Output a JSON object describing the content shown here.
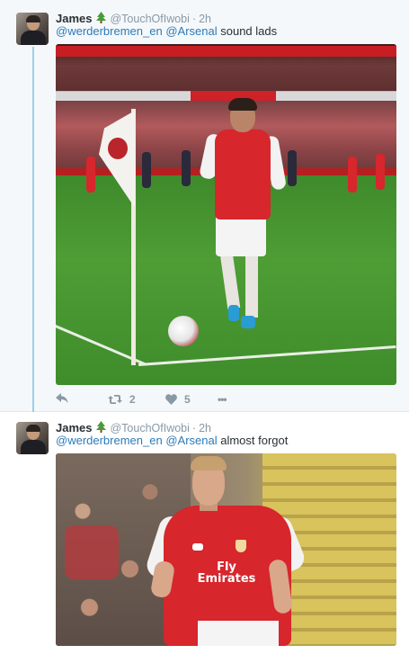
{
  "thread": [
    {
      "author": {
        "name": "James",
        "handle": "@TouchOfIwobi",
        "separator": "·",
        "time": "2h",
        "emoji_icon": "christmas-tree-icon"
      },
      "text": {
        "mention_1": "@werderbremen_en",
        "mention_2": "@Arsenal",
        "body": "sound lads"
      },
      "media": {
        "alt": "Arsenal player at the corner flag in a stadium"
      },
      "actions": {
        "reply_icon": "reply-icon",
        "retweet_icon": "retweet-icon",
        "retweet_count": "2",
        "like_icon": "heart-icon",
        "like_count": "5",
        "more_icon": "more-icon",
        "more_label": "•••"
      }
    },
    {
      "author": {
        "name": "James",
        "handle": "@TouchOfIwobi",
        "separator": "·",
        "time": "2h",
        "emoji_icon": "christmas-tree-icon"
      },
      "text": {
        "mention_1": "@werderbremen_en",
        "mention_2": "@Arsenal",
        "body": "almost forgot"
      },
      "media": {
        "alt": "Arsenal player in red home kit in front of a crowd",
        "sponsor_text": "Fly Emirates"
      }
    }
  ],
  "colors": {
    "link": "#2b7bb9",
    "muted": "#8899a6",
    "thread_line": "#9ad0e8",
    "conversation_bg": "#f5f8fa"
  }
}
